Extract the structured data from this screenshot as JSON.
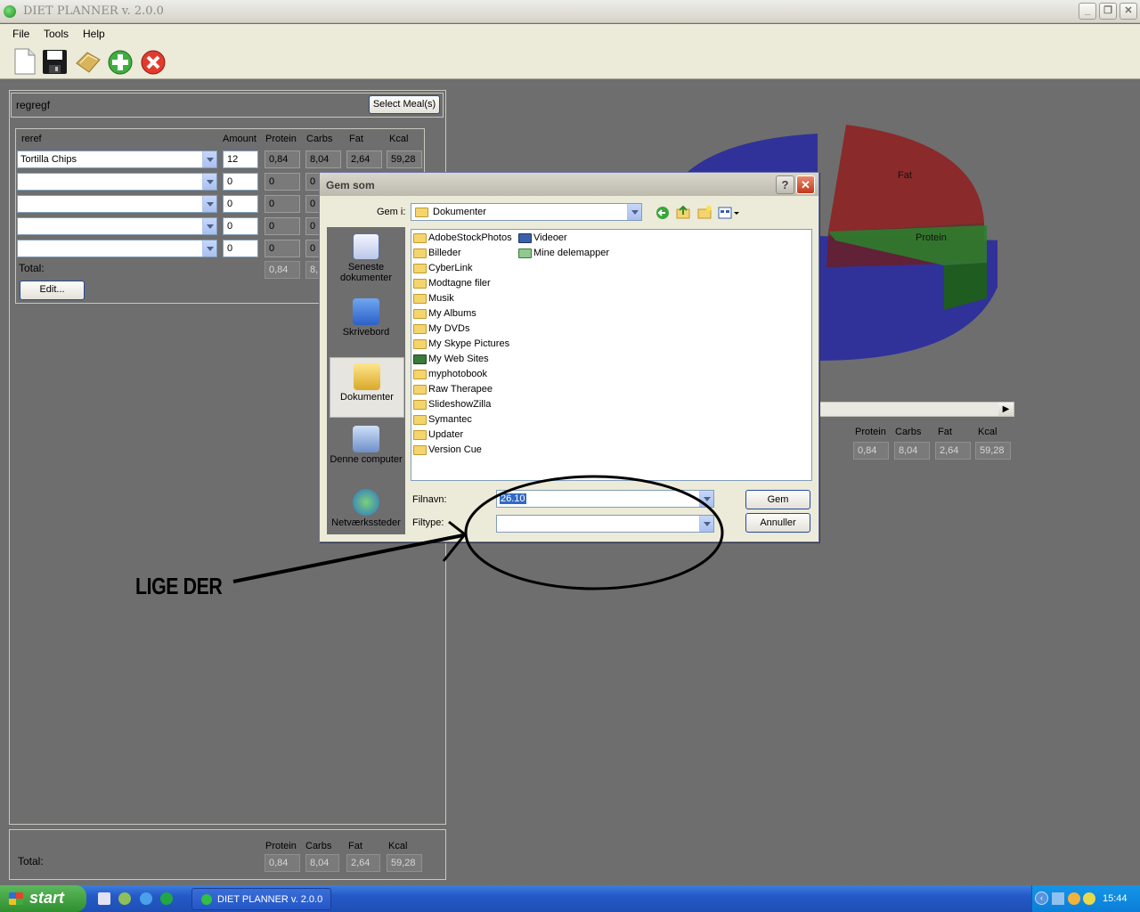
{
  "window": {
    "title": "DIET PLANNER v. 2.0.0"
  },
  "menu": [
    "File",
    "Tools",
    "Help"
  ],
  "toolbar": {
    "icons": [
      "new-file-icon",
      "save-icon",
      "open-icon",
      "add-icon",
      "delete-icon"
    ]
  },
  "meal": {
    "name": "regregf",
    "select_button": "Select Meal(s)",
    "group_name": "reref",
    "columns": [
      "Amount",
      "Protein",
      "Carbs",
      "Fat",
      "Kcal"
    ],
    "rows": [
      {
        "food": "Tortilla Chips",
        "amount": "12",
        "protein": "0,84",
        "carbs": "8,04",
        "fat": "2,64",
        "kcal": "59,28"
      },
      {
        "food": "",
        "amount": "0",
        "protein": "0",
        "carbs": "0"
      },
      {
        "food": "",
        "amount": "0",
        "protein": "0",
        "carbs": "0"
      },
      {
        "food": "",
        "amount": "0",
        "protein": "0",
        "carbs": "0"
      },
      {
        "food": "",
        "amount": "0",
        "protein": "0",
        "carbs": "0"
      }
    ],
    "total_label": "Total:",
    "totals": {
      "protein": "0,84",
      "carbs": "8,"
    },
    "edit_button": "Edit..."
  },
  "totals_panel": {
    "label": "Total:",
    "columns": [
      "Protein",
      "Carbs",
      "Fat",
      "Kcal"
    ],
    "values": [
      "0,84",
      "8,04",
      "2,64",
      "59,28"
    ]
  },
  "right_panel": {
    "columns": [
      "Protein",
      "Carbs",
      "Fat",
      "Kcal"
    ],
    "values": [
      "0,84",
      "8,04",
      "2,64",
      "59,28"
    ]
  },
  "chart_data": {
    "type": "pie",
    "labels": [
      "Fat",
      "Protein"
    ],
    "slice_colors": {
      "fat": "#8b2a2a",
      "protein": "#2e7d2e",
      "carbs": "#2a2a9e"
    }
  },
  "dialog": {
    "title": "Gem som",
    "save_in_label": "Gem i:",
    "save_in_value": "Dokumenter",
    "places": [
      "Seneste dokumenter",
      "Skrivebord",
      "Dokumenter",
      "Denne computer",
      "Netværkssteder"
    ],
    "files_col1": [
      "AdobeStockPhotos",
      "Billeder",
      "CyberLink",
      "Modtagne filer",
      "Musik",
      "My Albums",
      "My DVDs",
      "My Skype Pictures",
      "My Web Sites",
      "myphotobook",
      "Raw Therapee",
      "SlideshowZilla",
      "Symantec",
      "Updater",
      "Version Cue"
    ],
    "files_col2": [
      "Videoer",
      "Mine delemapper"
    ],
    "filename_label": "Filnavn:",
    "filename_value": "26.10",
    "filetype_label": "Filtype:",
    "filetype_value": "",
    "save_button": "Gem",
    "cancel_button": "Annuller"
  },
  "annotation": {
    "text": "LIGE DER"
  },
  "taskbar": {
    "start": "start",
    "task": "DIET PLANNER v. 2.0.0",
    "clock": "15:44"
  }
}
